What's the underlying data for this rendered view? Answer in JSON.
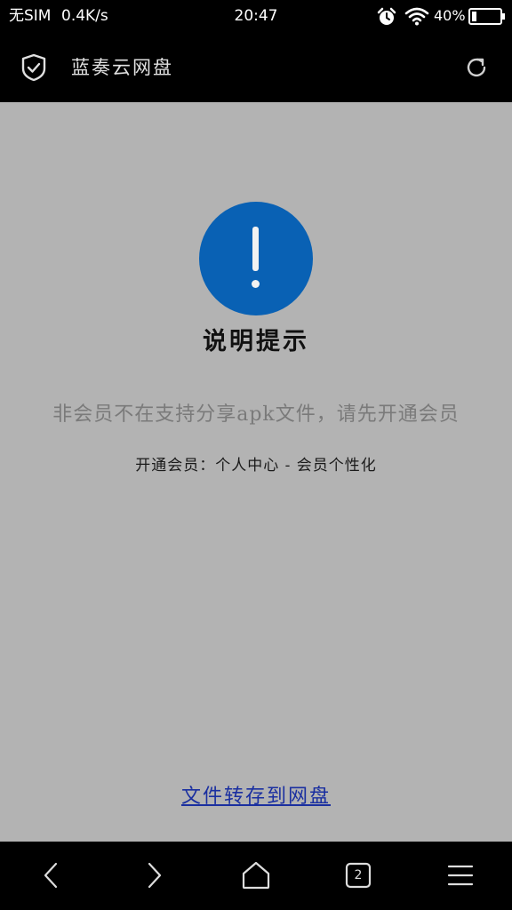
{
  "status_bar": {
    "carrier": "无SIM",
    "network_speed": "0.4K/s",
    "time": "20:47",
    "battery": "40%",
    "alarm_icon": "alarm-clock-icon",
    "wifi_icon": "wifi-icon",
    "battery_icon": "battery-icon"
  },
  "app_bar": {
    "title": "蓝奏云网盘",
    "left_icon": "shield-check-icon",
    "right_icon": "refresh-icon"
  },
  "dialog": {
    "icon": "exclamation-icon",
    "icon_color": "#0961b4",
    "title": "说明提示",
    "message": "非会员不在支持分享apk文件，请先开通会员",
    "hint": "开通会员：个人中心 - 会员个性化"
  },
  "link": {
    "label": "文件转存到网盘",
    "color": "#1a2fa0"
  },
  "bottom_nav": {
    "back_icon": "chevron-left-icon",
    "forward_icon": "chevron-right-icon",
    "home_icon": "home-icon",
    "tabs_count": "2",
    "menu_icon": "menu-icon"
  },
  "colors": {
    "page_background": "#b3b3b3",
    "bar_background": "#000000"
  }
}
